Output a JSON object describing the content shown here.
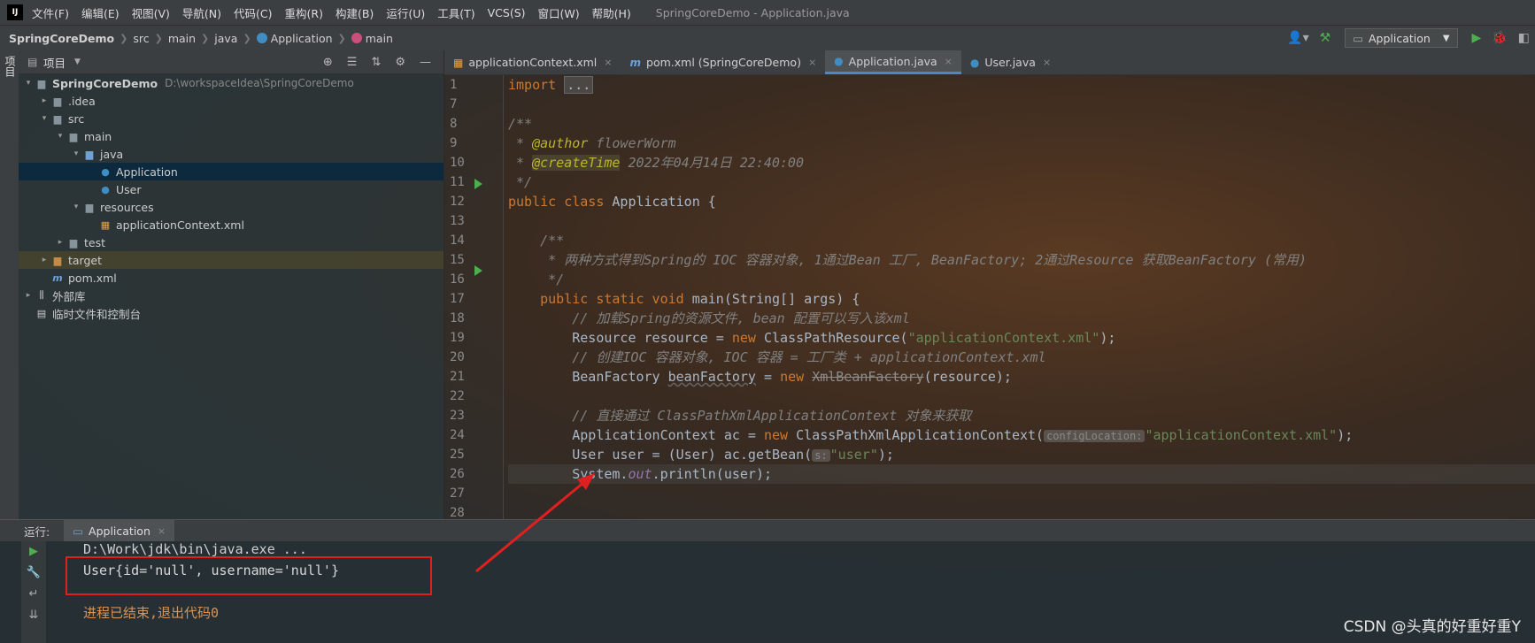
{
  "menubar": {
    "logo": "IJ",
    "items": [
      "文件(F)",
      "编辑(E)",
      "视图(V)",
      "导航(N)",
      "代码(C)",
      "重构(R)",
      "构建(B)",
      "运行(U)",
      "工具(T)",
      "VCS(S)",
      "窗口(W)",
      "帮助(H)"
    ],
    "window_title": "SpringCoreDemo - Application.java"
  },
  "breadcrumb": [
    "SpringCoreDemo",
    "src",
    "main",
    "java",
    "Application",
    "main"
  ],
  "toolbar": {
    "run_config": "Application"
  },
  "left_stripe": {
    "label": "项目"
  },
  "project": {
    "title": "项目",
    "tree": [
      {
        "label": "SpringCoreDemo",
        "hint": "D:\\workspaceIdea\\SpringCoreDemo",
        "depth": 0,
        "arrow": "▾",
        "icon": "folder"
      },
      {
        "label": ".idea",
        "depth": 1,
        "arrow": "▸",
        "icon": "folder"
      },
      {
        "label": "src",
        "depth": 1,
        "arrow": "▾",
        "icon": "folder"
      },
      {
        "label": "main",
        "depth": 2,
        "arrow": "▾",
        "icon": "folder"
      },
      {
        "label": "java",
        "depth": 3,
        "arrow": "▾",
        "icon": "folder-blue"
      },
      {
        "label": "Application",
        "depth": 4,
        "arrow": "",
        "icon": "class-run",
        "selected": true
      },
      {
        "label": "User",
        "depth": 4,
        "arrow": "",
        "icon": "class"
      },
      {
        "label": "resources",
        "depth": 3,
        "arrow": "▾",
        "icon": "folder"
      },
      {
        "label": "applicationContext.xml",
        "depth": 4,
        "arrow": "",
        "icon": "xml"
      },
      {
        "label": "test",
        "depth": 2,
        "arrow": "▸",
        "icon": "folder"
      },
      {
        "label": "target",
        "depth": 1,
        "arrow": "▸",
        "icon": "folder-orange",
        "highlight": true
      },
      {
        "label": "pom.xml",
        "depth": 1,
        "arrow": "",
        "icon": "maven"
      },
      {
        "label": "外部库",
        "depth": 0,
        "arrow": "▸",
        "icon": "library"
      },
      {
        "label": "临时文件和控制台",
        "depth": 0,
        "arrow": "",
        "icon": "scratch"
      }
    ]
  },
  "tabs": [
    {
      "label": "applicationContext.xml",
      "icon": "xml"
    },
    {
      "label": "pom.xml (SpringCoreDemo)",
      "icon": "maven"
    },
    {
      "label": "Application.java",
      "icon": "class",
      "active": true
    },
    {
      "label": "User.java",
      "icon": "class"
    }
  ],
  "editor": {
    "line_numbers": [
      "1",
      "7",
      "8",
      "9",
      "10",
      "11",
      "12",
      "13",
      "14",
      "15",
      "16",
      "17",
      "18",
      "19",
      "20",
      "21",
      "22",
      "23",
      "24",
      "25",
      "26",
      "27",
      "28"
    ],
    "code": {
      "import_kw": "import",
      "import_fold": "...",
      "doc_open": "/**",
      "author_tag": "@author",
      "author_val": "flowerWorm",
      "create_tag": "@createTime",
      "create_val": "2022年04月14日 22:40:00",
      "doc_close": " */",
      "class_kw": "public class",
      "class_name": "Application {",
      "doc2_open": "/**",
      "doc2_body": " * 两种方式得到Spring的 IOC 容器对象, 1通过Bean 工厂, BeanFactory; 2通过Resource 获取BeanFactory (常用)",
      "doc2_close": " */",
      "main_kw": "public static void",
      "main_sig": "main(String[] args) {",
      "c1": "// 加载Spring的资源文件, bean 配置可以写入该xml",
      "l19_a": "Resource ",
      "l19_b": "resource",
      "l19_c": " = ",
      "l19_new": "new",
      "l19_d": " ClassPathResource(",
      "l19_str": "\"applicationContext.xml\"",
      "l19_e": ");",
      "c2": "// 创建IOC 容器对象, IOC 容器 = 工厂类 + applicationContext.xml",
      "l21_a": "BeanFactory ",
      "l21_b": "beanFactory",
      "l21_c": " = ",
      "l21_new": "new",
      "l21_depr": "XmlBeanFactory",
      "l21_d": "(resource);",
      "c3": "// 直接通过 ClassPathXmlApplicationContext 对象来获取",
      "l24_a": "ApplicationContext ac = ",
      "l24_new": "new",
      "l24_b": " ClassPathXmlApplicationContext(",
      "l24_hint": "configLocation:",
      "l24_str": "\"applicationContext.xml\"",
      "l24_c": ");",
      "l25_a": "User user = (User) ac.getBean(",
      "l25_hint": "s:",
      "l25_str": "\"user\"",
      "l25_c": ");",
      "l26_a": "System.",
      "l26_field": "out",
      "l26_b": ".println(user);"
    }
  },
  "run": {
    "label": "运行:",
    "tab": "Application",
    "cmd": "D:\\Work\\jdk\\bin\\java.exe ...",
    "output": "User{id='null', username='null'}",
    "exit": "进程已结束,退出代码0"
  },
  "watermark": "CSDN @头真的好重好重Y",
  "colors": {
    "accent": "#4a88c7",
    "callout": "#e02020",
    "keyword": "#cc7832",
    "string": "#6a8759"
  }
}
